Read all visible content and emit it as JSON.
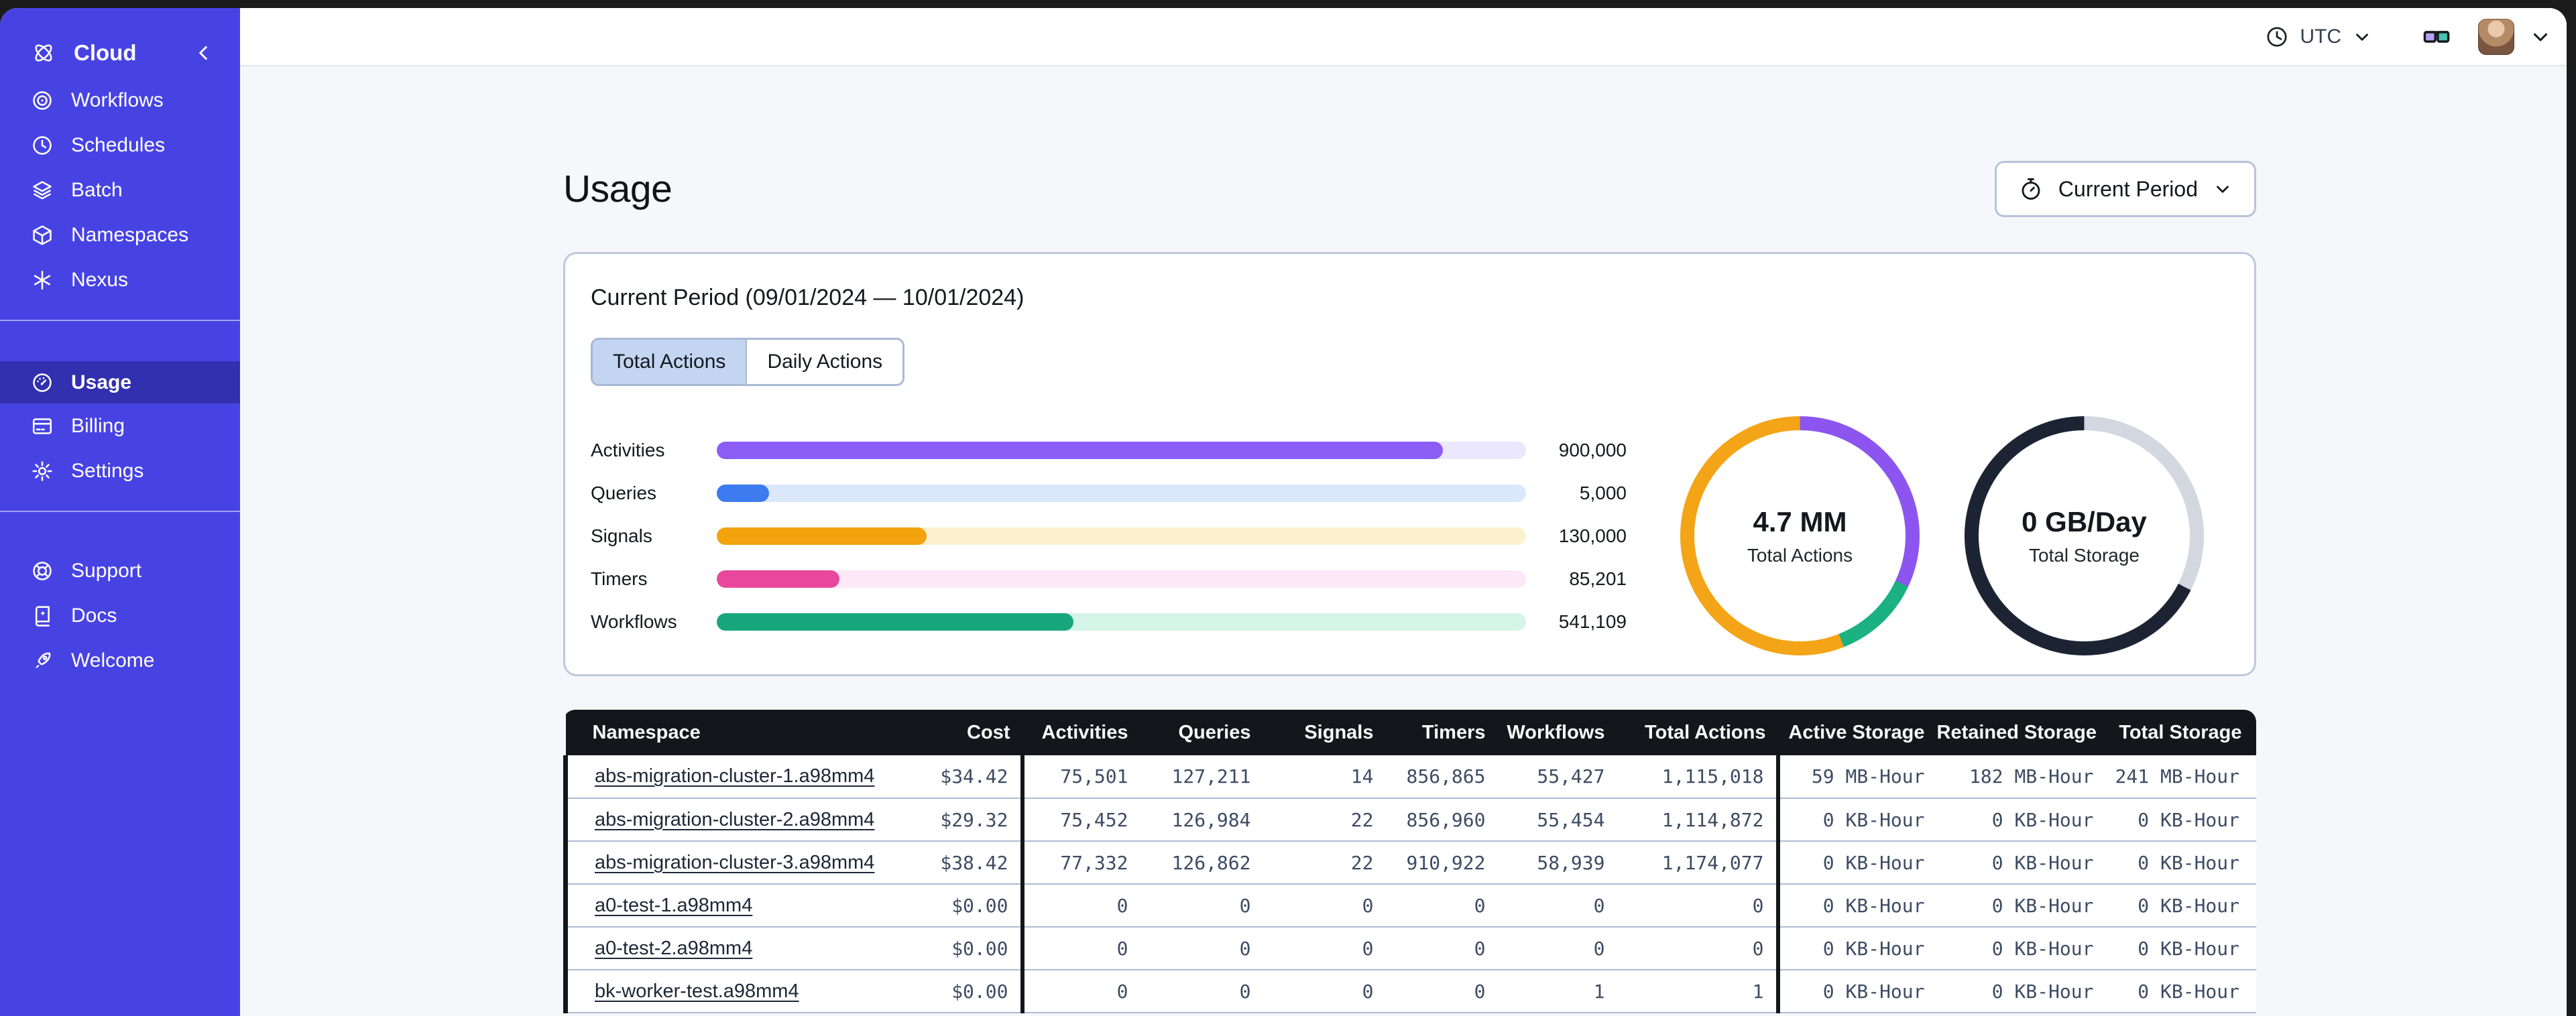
{
  "sidebar": {
    "header": {
      "label": "Cloud"
    },
    "primary_items": [
      {
        "label": "Workflows"
      },
      {
        "label": "Schedules"
      },
      {
        "label": "Batch"
      },
      {
        "label": "Namespaces"
      },
      {
        "label": "Nexus"
      }
    ],
    "account_items": [
      {
        "label": "Usage",
        "active": true
      },
      {
        "label": "Billing"
      },
      {
        "label": "Settings"
      }
    ],
    "footer_items": [
      {
        "label": "Support"
      },
      {
        "label": "Docs"
      },
      {
        "label": "Welcome"
      }
    ],
    "colors": {
      "bg": "#4743E3",
      "active_bg": "#38359F"
    }
  },
  "topbar": {
    "timezone": "UTC"
  },
  "page": {
    "title": "Usage",
    "period_button": "Current Period"
  },
  "usage_card": {
    "title": "Current Period (09/01/2024 — 10/01/2024)",
    "tabs": [
      {
        "label": "Total Actions",
        "active": true
      },
      {
        "label": "Daily Actions",
        "active": false
      }
    ],
    "bars": [
      {
        "name": "bar-activities",
        "label": "Activities",
        "value": "900,000",
        "fill_pct": 89.7,
        "color": "#8B5CF6",
        "track": "#EBE7FC"
      },
      {
        "name": "bar-queries",
        "label": "Queries",
        "value": "5,000",
        "fill_pct": 6.5,
        "color": "#3C7BF0",
        "track": "#DBE7FB"
      },
      {
        "name": "bar-signals",
        "label": "Signals",
        "value": "130,000",
        "fill_pct": 25.9,
        "color": "#F2A30E",
        "track": "#FCF1CE"
      },
      {
        "name": "bar-timers",
        "label": "Timers",
        "value": "85,201",
        "fill_pct": 15.2,
        "color": "#E8479B",
        "track": "#FCE8F6"
      },
      {
        "name": "bar-workflows",
        "label": "Workflows",
        "value": "541,109",
        "fill_pct": 44.1,
        "color": "#16A77C",
        "track": "#D4F5E7"
      }
    ],
    "donuts": [
      {
        "value": "4.7 MM",
        "label": "Total Actions",
        "segments": [
          {
            "color": "#8C55F0",
            "pct": 32
          },
          {
            "color": "#1CB180",
            "pct": 12
          },
          {
            "color": "#F4A417",
            "pct": 56
          }
        ]
      },
      {
        "value": "0 GB/Day",
        "label": "Total Storage",
        "segments": [
          {
            "color": "#D3D7DF",
            "pct": 32.5
          },
          {
            "color": "#1C2434",
            "pct": 67.5
          }
        ]
      }
    ]
  },
  "chart_data": [
    {
      "type": "bar",
      "categories": [
        "Activities",
        "Queries",
        "Signals",
        "Timers",
        "Workflows"
      ],
      "values": [
        900000,
        5000,
        130000,
        85201,
        541109
      ],
      "title": "Current Period (09/01/2024 — 10/01/2024)",
      "xlabel": "",
      "ylabel": ""
    },
    {
      "type": "pie",
      "title": "Total Actions",
      "center_label": "4.7 MM",
      "slices": [
        {
          "name": "purple",
          "pct": 32
        },
        {
          "name": "green",
          "pct": 12
        },
        {
          "name": "orange",
          "pct": 56
        }
      ]
    },
    {
      "type": "pie",
      "title": "Total Storage",
      "center_label": "0 GB/Day",
      "slices": [
        {
          "name": "gray",
          "pct": 32.5
        },
        {
          "name": "dark",
          "pct": 67.5
        }
      ]
    }
  ],
  "table": {
    "columns": [
      "Namespace",
      "Cost",
      "Activities",
      "Queries",
      "Signals",
      "Timers",
      "Workflows",
      "Total Actions",
      "Active Storage",
      "Retained Storage",
      "Total Storage"
    ],
    "rows": [
      {
        "cells": [
          "abs-migration-cluster-1.a98mm4",
          "$34.42",
          "75,501",
          "127,211",
          "14",
          "856,865",
          "55,427",
          "1,115,018",
          "59 MB-Hour",
          "182 MB-Hour",
          "241 MB-Hour"
        ]
      },
      {
        "cells": [
          "abs-migration-cluster-2.a98mm4",
          "$29.32",
          "75,452",
          "126,984",
          "22",
          "856,960",
          "55,454",
          "1,114,872",
          "0 KB-Hour",
          "0 KB-Hour",
          "0 KB-Hour"
        ]
      },
      {
        "cells": [
          "abs-migration-cluster-3.a98mm4",
          "$38.42",
          "77,332",
          "126,862",
          "22",
          "910,922",
          "58,939",
          "1,174,077",
          "0 KB-Hour",
          "0 KB-Hour",
          "0 KB-Hour"
        ]
      },
      {
        "cells": [
          "a0-test-1.a98mm4",
          "$0.00",
          "0",
          "0",
          "0",
          "0",
          "0",
          "0",
          "0 KB-Hour",
          "0 KB-Hour",
          "0 KB-Hour"
        ]
      },
      {
        "cells": [
          "a0-test-2.a98mm4",
          "$0.00",
          "0",
          "0",
          "0",
          "0",
          "0",
          "0",
          "0 KB-Hour",
          "0 KB-Hour",
          "0 KB-Hour"
        ]
      },
      {
        "cells": [
          "bk-worker-test.a98mm4",
          "$0.00",
          "0",
          "0",
          "0",
          "0",
          "1",
          "1",
          "0 KB-Hour",
          "0 KB-Hour",
          "0 KB-Hour"
        ]
      }
    ]
  }
}
